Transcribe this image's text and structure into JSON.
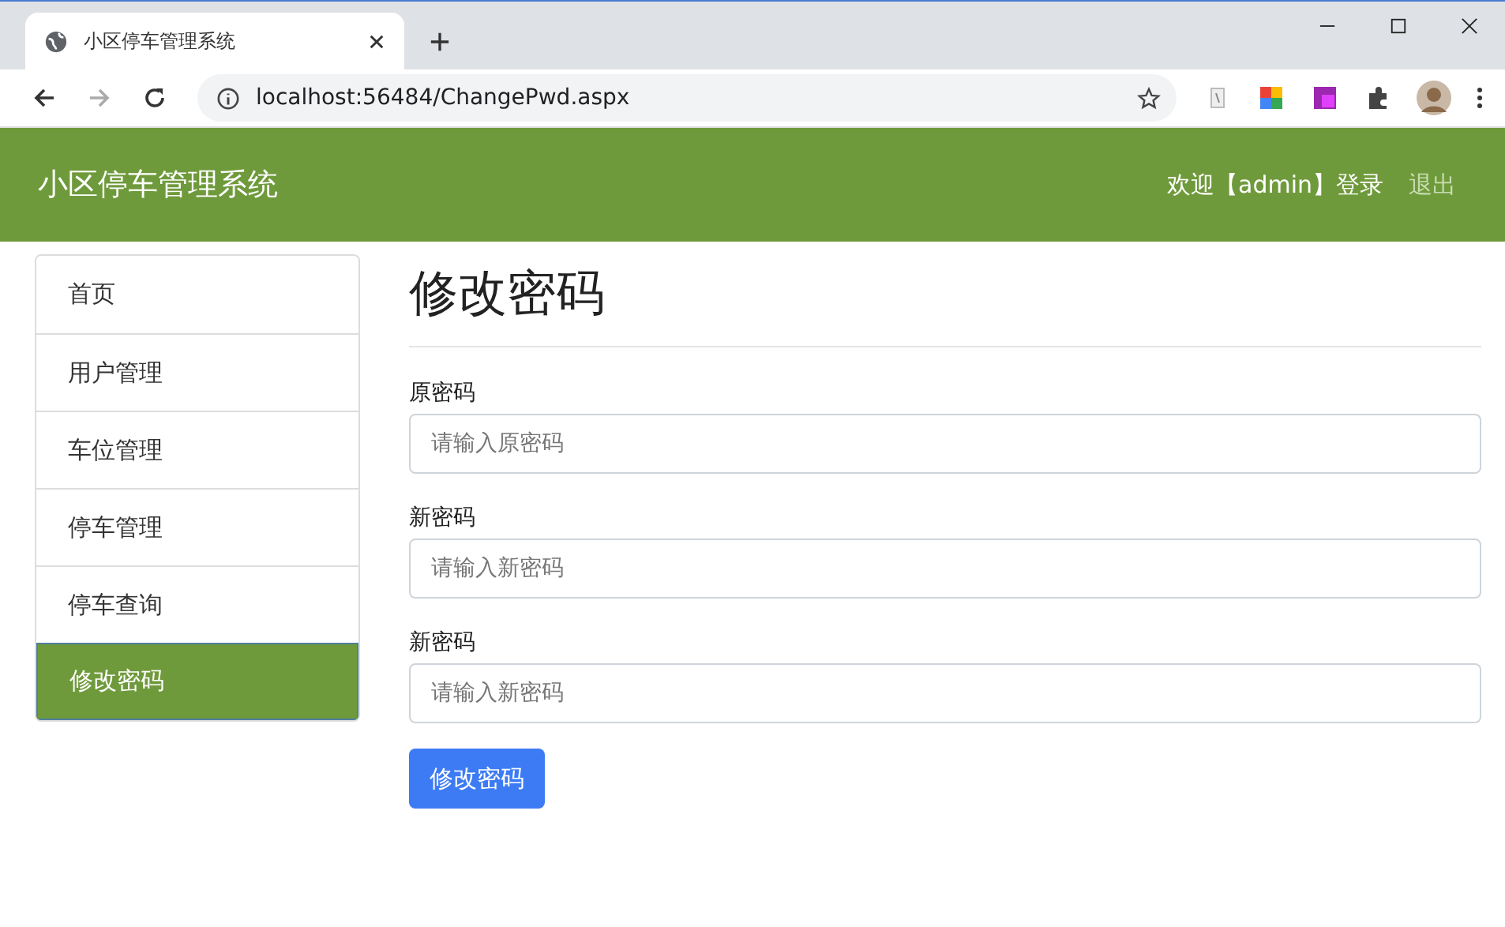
{
  "browser": {
    "tab_title": "小区停车管理系统",
    "url": "localhost:56484/ChangePwd.aspx"
  },
  "navbar": {
    "brand": "小区停车管理系统",
    "welcome": "欢迎【admin】登录",
    "logout": "退出"
  },
  "sidebar": {
    "items": [
      {
        "label": "首页",
        "selected": false
      },
      {
        "label": "用户管理",
        "selected": false
      },
      {
        "label": "车位管理",
        "selected": false
      },
      {
        "label": "停车管理",
        "selected": false
      },
      {
        "label": "停车查询",
        "selected": false
      },
      {
        "label": "修改密码",
        "selected": true
      }
    ]
  },
  "page": {
    "title": "修改密码",
    "fields": [
      {
        "label": "原密码",
        "placeholder": "请输入原密码"
      },
      {
        "label": "新密码",
        "placeholder": "请输入新密码"
      },
      {
        "label": "新密码",
        "placeholder": "请输入新密码"
      }
    ],
    "submit": "修改密码"
  }
}
